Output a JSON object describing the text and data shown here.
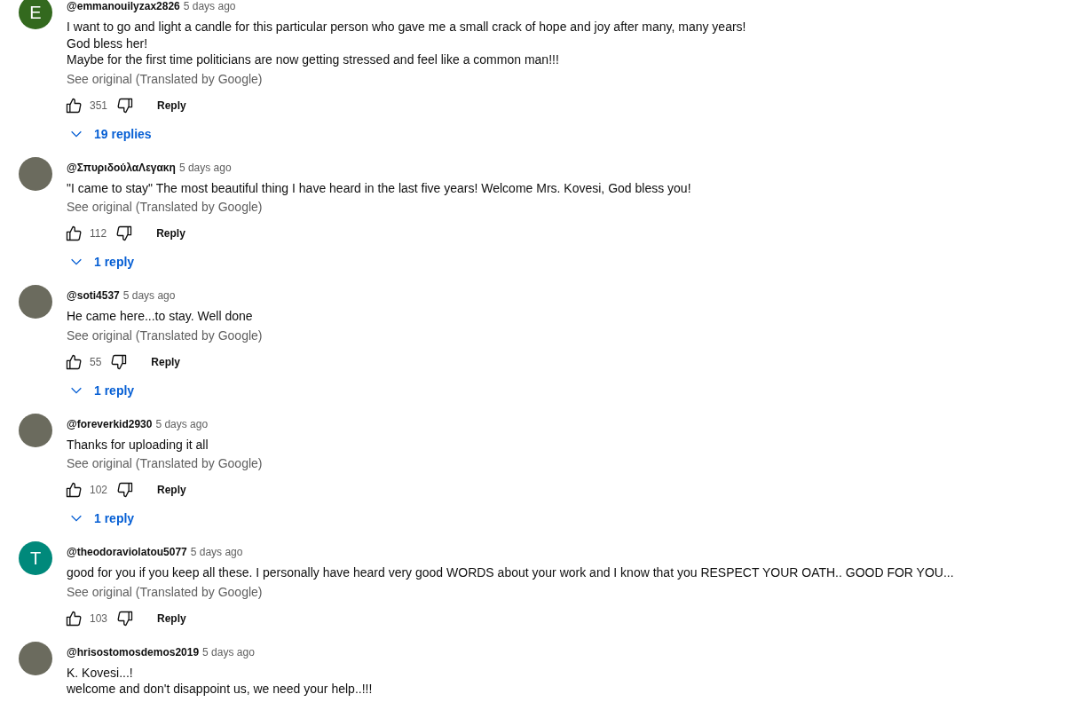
{
  "comments": [
    {
      "author": "@emmanouilyzax2826",
      "time": "5 days ago",
      "avatar": {
        "kind": "letter",
        "letter": "E",
        "color": "#33691e"
      },
      "lines": [
        "I want to go and light a candle for this particular person who gave me a small crack of hope and joy after many, many years!",
        "God bless her!",
        "Maybe for the first time politicians are now getting stressed and feel like a common man!!!"
      ],
      "translation": "See original (Translated by Google)",
      "likes": "351",
      "reply": "Reply",
      "replies": "19 replies"
    },
    {
      "author": "@ΣπυριδούλαΛεγακη",
      "time": "5 days ago",
      "avatar": {
        "kind": "photo"
      },
      "lines": [
        "\"I came to stay\" The most beautiful thing I have heard in the last five years! Welcome Mrs. Kovesi, God bless you!"
      ],
      "translation": "See original (Translated by Google)",
      "likes": "112",
      "reply": "Reply",
      "replies": "1 reply"
    },
    {
      "author": "@soti4537",
      "time": "5 days ago",
      "avatar": {
        "kind": "photo"
      },
      "lines": [
        "He came here...to stay. Well done"
      ],
      "translation": "See original (Translated by Google)",
      "likes": "55",
      "reply": "Reply",
      "replies": "1 reply"
    },
    {
      "author": "@foreverkid2930",
      "time": "5 days ago",
      "avatar": {
        "kind": "photo"
      },
      "lines": [
        "Thanks for uploading it all"
      ],
      "translation": "See original (Translated by Google)",
      "likes": "102",
      "reply": "Reply",
      "replies": "1 reply"
    },
    {
      "author": "@theodoraviolatou5077",
      "time": "5 days ago",
      "avatar": {
        "kind": "letter",
        "letter": "T",
        "color": "#00897b"
      },
      "lines": [
        "good for you if you keep all these. I personally have heard very good WORDS about your work and I know that you RESPECT YOUR OATH.. GOOD FOR YOU..."
      ],
      "translation": "See original (Translated by Google)",
      "likes": "103",
      "reply": "Reply"
    },
    {
      "author": "@hrisostomosdemos2019",
      "time": "5 days ago",
      "avatar": {
        "kind": "photo"
      },
      "lines": [
        "K. Kovesi...!",
        "welcome and don't disappoint us, we need your help..!!!"
      ]
    }
  ]
}
